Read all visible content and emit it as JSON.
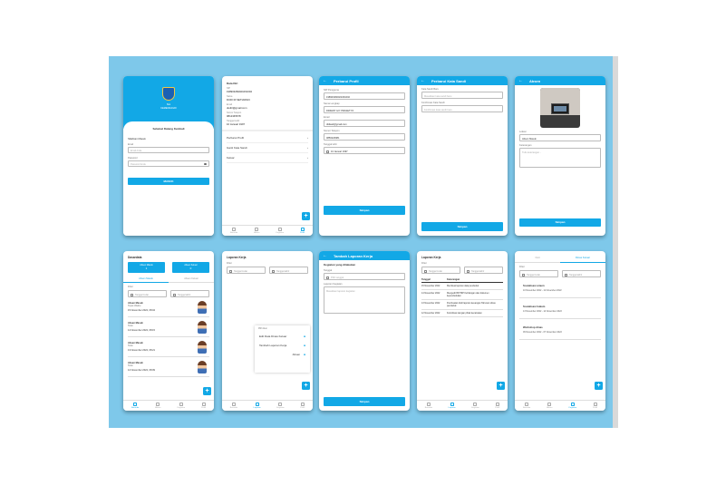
{
  "colors": {
    "primary": "#12a8e6",
    "board": "#7ec8ea"
  },
  "login": {
    "logo_text_1": "Sisi",
    "logo_text_2": "KEMENDAGRI",
    "welcome": "Selamat Datang Kembali",
    "subtitle": "Silahkan Masuk",
    "email_label": "Email",
    "email_placeholder": "Email Anda",
    "password_label": "Password",
    "password_placeholder": "Password Anda",
    "login_button": "MASUK"
  },
  "profile": {
    "section": "Data Diri",
    "nip_label": "NIP",
    "nip_value": "198903282021061002",
    "name_label": "Nama",
    "name_value": "DUDI RI SETIAWAN",
    "email_label": "Email",
    "email_value": "dudiri@gmail.com",
    "phone_label": "Nomor Telepon",
    "phone_value": "0812345678",
    "dob_label": "Tanggal Lahir",
    "dob_value": "10 Januari 1997",
    "menu": [
      "Perbarui Profil",
      "Ganti Kata Sandi",
      "Keluar"
    ],
    "nav": [
      "Beranda",
      "Absen",
      "Kegiatan",
      "Profil"
    ]
  },
  "edit_profile": {
    "title": "Perbarui Profil",
    "fields": [
      {
        "label": "NIP Pengguna",
        "value": "198903282021061002"
      },
      {
        "label": "Nama Lengkap",
        "value": "DIDIENT GIY PRASETYO"
      },
      {
        "label": "Email",
        "value": "didiasd@gmail.com"
      },
      {
        "label": "Nomor Telepon",
        "value": "0856226981"
      },
      {
        "label": "Tanggal lahir",
        "value": "10 Januari 1997"
      }
    ],
    "save_button": "Simpan"
  },
  "change_password": {
    "title": "Perbarui Kata Sandi",
    "new_label": "Kata Sandi Baru",
    "new_placeholder": "Masukkan kata sandi baru",
    "confirm_label": "Konfirmasi Kata Sandi",
    "confirm_placeholder": "Konfirmasi kata sandi baru",
    "save_button": "Simpan"
  },
  "absen": {
    "title": "Absen",
    "location_label": "Lokasi",
    "location_value": "Absen Masuk",
    "note_label": "Keterangan",
    "note_placeholder": "Tulis keterangan...",
    "save_button": "Simpan"
  },
  "dashboard": {
    "title": "Dasardata",
    "card1_title": "Absen Masuk",
    "card1_value": "1",
    "card2_title": "Absen Keluar",
    "card2_value": "0",
    "tab1": "Absen Masuk",
    "tab2": "Absen Keluar",
    "filter_label": "Filter",
    "from_placeholder": "Tanggal mulai",
    "to_placeholder": "Tanggal akhir",
    "entries": [
      {
        "type": "Absen Masuk",
        "status": "Tepat Waktu",
        "date": "15 November 2022, 08:04"
      },
      {
        "type": "Absen Masuk",
        "status": "Telat",
        "date": "14 November 2022, 08:15"
      },
      {
        "type": "Absen Masuk",
        "status": "Telat",
        "date": "13 November 2022, 08:21"
      },
      {
        "type": "Absen Masuk",
        "status": "Telat",
        "date": "12 November 2022, 08:09"
      }
    ],
    "nav": [
      "Beranda",
      "Absen",
      "Kegiatan",
      "Profil"
    ]
  },
  "laporan_menu": {
    "title": "Laporan Kerja",
    "filter_label": "Filter",
    "from_placeholder": "Tanggal mulai",
    "to_placeholder": "Tanggal akhir",
    "popup_header": "Pilih Aksi",
    "options": [
      "Edit Data Dinas Keluar",
      "Tambah Laporan Kerja",
      "Absen"
    ],
    "nav": [
      "Beranda",
      "Laporan",
      "Kegiatan",
      "Profil"
    ]
  },
  "add_laporan": {
    "title": "Tambah Laporan Kerja",
    "subtitle": "Kegiatan yang dilakukan",
    "date_label": "Tanggal",
    "date_placeholder": "Pilih tanggal",
    "desc_label": "Laporan Kegiatan",
    "desc_placeholder": "Masukkan laporan kegiatan",
    "save_button": "Simpan"
  },
  "laporan_list": {
    "title": "Laporan Kerja",
    "filter_label": "Filter",
    "from_placeholder": "Tanggal mulai",
    "to_placeholder": "Tanggal akhir",
    "col_date": "Tanggal",
    "col_desc": "Keterangan",
    "rows": [
      {
        "date": "15 November 2022",
        "desc": "Membuat laporan data penduduk"
      },
      {
        "date": "14 November 2022",
        "desc": "Mengedit BIP BIP Kehilangan dan dokumen kependudukan"
      },
      {
        "date": "13 November 2022",
        "desc": "Pembuatan draft laporan keuangan Tahunan dinas penduduk"
      },
      {
        "date": "12 November 2022",
        "desc": "Koordinasi dengan pihak kecamatan"
      }
    ],
    "nav": [
      "Beranda",
      "Laporan",
      "Kegiatan",
      "Profil"
    ]
  },
  "dinas": {
    "tab1": "Cuti",
    "tab2": "Dinas Keluar",
    "filter_label": "Filter",
    "from_placeholder": "Tanggal mulai",
    "to_placeholder": "Tanggal akhir",
    "items": [
      {
        "title": "Sosialisasi umum",
        "range": "10 November 2022 - 11 November 2022"
      },
      {
        "title": "Sosialisasi hukum",
        "range": "13 November 2022 - 14 November 2022"
      },
      {
        "title": "Workshop dinas",
        "range": "09 November 2022 - 07 November 2022"
      }
    ],
    "nav": [
      "Beranda",
      "Absen",
      "Kegiatan",
      "Profil"
    ]
  }
}
